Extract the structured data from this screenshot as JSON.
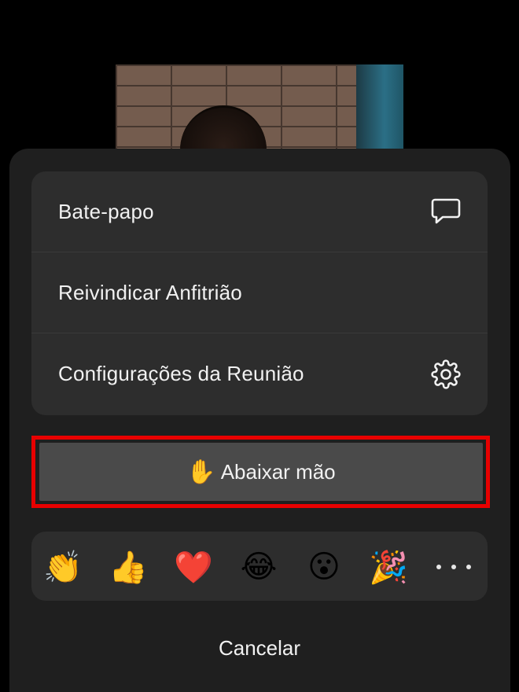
{
  "menu": {
    "items": [
      {
        "label": "Bate-papo",
        "icon": "chat-bubble-icon"
      },
      {
        "label": "Reivindicar Anfitrião",
        "icon": ""
      },
      {
        "label": "Configurações da Reunião",
        "icon": "gear-icon"
      }
    ]
  },
  "hand_button": {
    "emoji": "✋",
    "label": "Abaixar mão",
    "highlight_color": "#e80000"
  },
  "reactions": {
    "items": [
      {
        "emoji": "👏",
        "icon": "clapping-hands-icon"
      },
      {
        "emoji": "👍",
        "icon": "thumbs-up-icon"
      },
      {
        "emoji": "❤️",
        "icon": "heart-icon"
      },
      {
        "emoji": "😂",
        "icon": "laughing-tears-icon"
      },
      {
        "emoji": "😮",
        "icon": "surprised-face-icon"
      },
      {
        "emoji": "🎉",
        "icon": "party-popper-icon"
      }
    ],
    "more_icon": "more-dots-icon"
  },
  "cancel_label": "Cancelar",
  "colors": {
    "background": "#000000",
    "sheet": "#1f1f1f",
    "card": "#2d2d2d",
    "button": "#4a4a4a",
    "text": "#f1f1f1"
  }
}
